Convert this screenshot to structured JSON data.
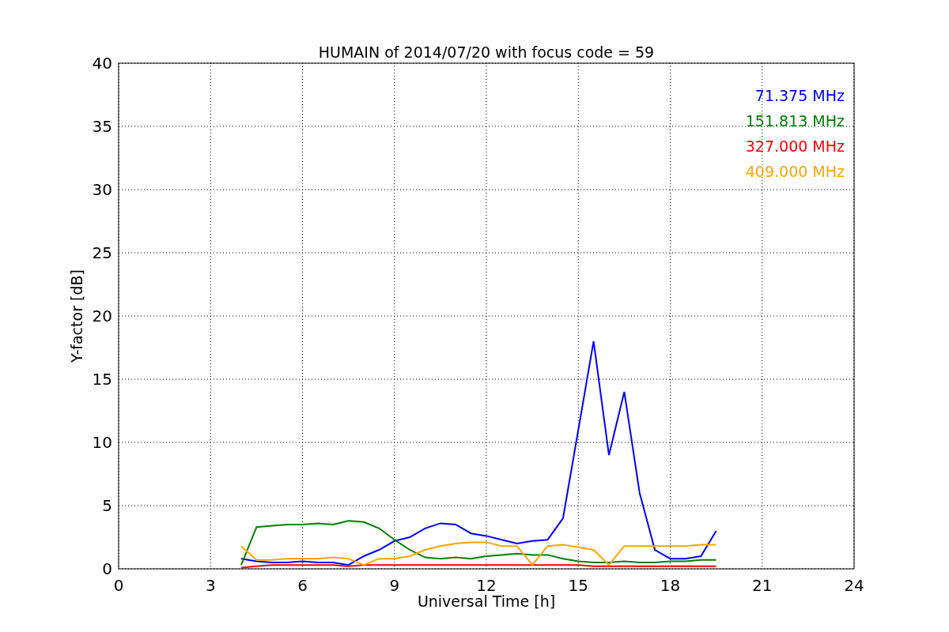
{
  "figure": {
    "chart_data": {
      "type": "line",
      "title": "HUMAIN of 2014/07/20 with focus code = 59",
      "xlabel": "Universal Time [h]",
      "ylabel": "Y-factor [dB]",
      "x": [
        4,
        4.5,
        5,
        5.5,
        6,
        6.5,
        7,
        7.5,
        8,
        8.5,
        9,
        9.5,
        10,
        10.5,
        11,
        11.5,
        12,
        12.5,
        13,
        13.5,
        14,
        14.5,
        15,
        15.5,
        16,
        16.5,
        17,
        17.5,
        18,
        18.5,
        19,
        19.5
      ],
      "series": [
        {
          "name": "71.375 MHz",
          "color": "#0000ff",
          "values": [
            0.8,
            0.6,
            0.5,
            0.5,
            0.6,
            0.5,
            0.5,
            0.3,
            1.0,
            1.5,
            2.2,
            2.5,
            3.2,
            3.6,
            3.5,
            2.8,
            2.6,
            2.3,
            2.0,
            2.2,
            2.3,
            4,
            11,
            18,
            9,
            14,
            6,
            1.5,
            0.8,
            0.8,
            1.0,
            3
          ]
        },
        {
          "name": "151.813 MHz",
          "color": "#008000",
          "values": [
            0.3,
            3.3,
            3.4,
            3.5,
            3.5,
            3.6,
            3.5,
            3.8,
            3.7,
            3.2,
            2.3,
            1.5,
            0.9,
            0.8,
            0.9,
            0.8,
            1.0,
            1.1,
            1.2,
            1.1,
            1.1,
            0.8,
            0.6,
            0.5,
            0.5,
            0.6,
            0.5,
            0.5,
            0.6,
            0.6,
            0.7,
            0.7
          ]
        },
        {
          "name": "327.000 MHz",
          "color": "#ff0000",
          "values": [
            0.1,
            0.2,
            0.3,
            0.3,
            0.3,
            0.3,
            0.3,
            0.2,
            0.3,
            0.3,
            0.3,
            0.3,
            0.3,
            0.3,
            0.3,
            0.3,
            0.3,
            0.3,
            0.3,
            0.3,
            0.3,
            0.3,
            0.3,
            0.2,
            0.2,
            0.2,
            0.2,
            0.2,
            0.2,
            0.2,
            0.2,
            0.2
          ]
        },
        {
          "name": "409.000 MHz",
          "color": "#ffa500",
          "values": [
            1.8,
            0.7,
            0.7,
            0.8,
            0.8,
            0.8,
            0.9,
            0.8,
            0.3,
            0.8,
            0.8,
            1.0,
            1.5,
            1.8,
            2.0,
            2.1,
            2.1,
            1.8,
            1.8,
            0.3,
            1.8,
            1.9,
            1.7,
            1.5,
            0.3,
            1.8,
            1.8,
            1.8,
            1.8,
            1.8,
            1.9,
            1.9
          ]
        }
      ],
      "grid": true,
      "xlim": [
        0,
        24
      ],
      "ylim": [
        0,
        40
      ],
      "xticks": [
        0,
        3,
        6,
        9,
        12,
        15,
        18,
        21,
        24
      ],
      "yticks": [
        0,
        5,
        10,
        15,
        20,
        25,
        30,
        35,
        40
      ]
    }
  }
}
